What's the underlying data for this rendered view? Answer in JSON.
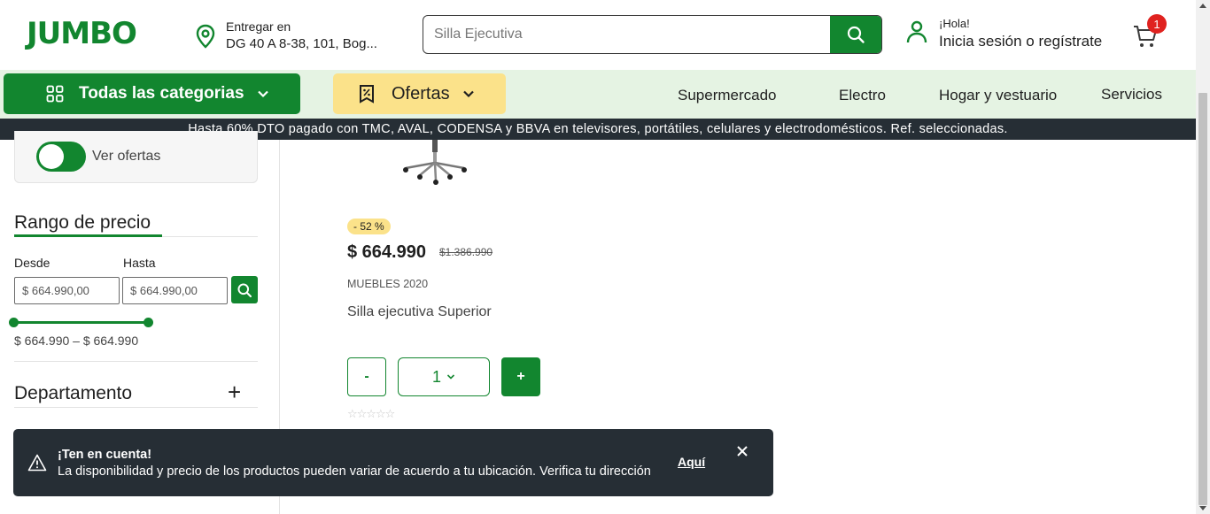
{
  "header": {
    "logo": "JUMBO",
    "delivery_label": "Entregar en",
    "delivery_address": "DG 40 A 8-38, 101, Bog...",
    "search_placeholder": "Silla Ejecutiva",
    "greeting": "¡Hola!",
    "login_text": "Inicia sesión o regístrate",
    "cart_count": "1"
  },
  "nav": {
    "categories_label": "Todas las categorias",
    "offers_label": "Ofertas",
    "links": [
      "Supermercado",
      "Electro",
      "Hogar y vestuario",
      "Servicios"
    ]
  },
  "promo_banner": "Hasta 60% DTO pagado con TMC, AVAL, CODENSA y BBVA en televisores, portátiles, celulares y electrodomésticos. Ref. seleccionadas.",
  "sidebar": {
    "offers_toggle_label": "Ver ofertas",
    "offers_toggle_on": true,
    "price_range_title": "Rango de precio",
    "from_label": "Desde",
    "to_label": "Hasta",
    "from_value": "$ 664.990,00",
    "to_value": "$ 664.990,00",
    "range_text": "$ 664.990 – $ 664.990",
    "department_title": "Departamento"
  },
  "product": {
    "discount_badge": "- 52 %",
    "price": "$ 664.990",
    "old_price": "$1.386.990",
    "brand": "MUEBLES 2020",
    "name": "Silla ejecutiva Superior",
    "minus_label": "-",
    "quantity": "1",
    "plus_label": "+",
    "rating_stars": "☆☆☆☆☆"
  },
  "toast": {
    "title": "¡Ten en cuenta!",
    "message": "La disponibilidad y precio de los productos pueden variar de acuerdo a tu ubicación. Verifica tu dirección",
    "link": "Aquí"
  },
  "colors": {
    "brand_green": "#12862f",
    "offers_yellow": "#fbe28a",
    "nav_bg": "#e5f3e3",
    "dark_bar": "#262e35",
    "badge_red": "#e0221f"
  }
}
